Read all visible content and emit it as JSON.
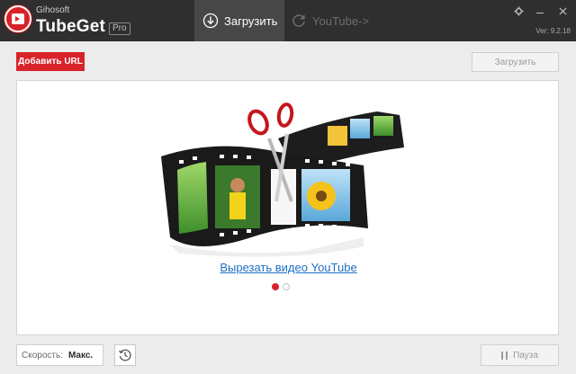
{
  "app": {
    "brand_small": "Gihosoft",
    "brand_name": "TubeGet",
    "edition": "Pro",
    "version": "Ver: 9.2.18"
  },
  "tabs": [
    {
      "label": "Загрузить",
      "icon": "download-circle-icon",
      "active": true
    },
    {
      "label": "YouTube->",
      "icon": "refresh-icon",
      "active": false
    }
  ],
  "window_controls": [
    "gear-icon",
    "minimize-icon",
    "close-icon"
  ],
  "toolbar": {
    "add_url_label": "Добавить URL",
    "download_label": "Загрузить"
  },
  "promo": {
    "link_text": "Вырезать видео YouTube",
    "slides_total": 2,
    "slide_active": 1
  },
  "bottom": {
    "speed_label": "Скорость:",
    "speed_value": "Макс.",
    "history_icon": "history-icon",
    "pause_label": "Пауза"
  },
  "colors": {
    "accent": "#d8232a",
    "titlebar": "#2f2f2f",
    "link": "#1e6fc6"
  }
}
